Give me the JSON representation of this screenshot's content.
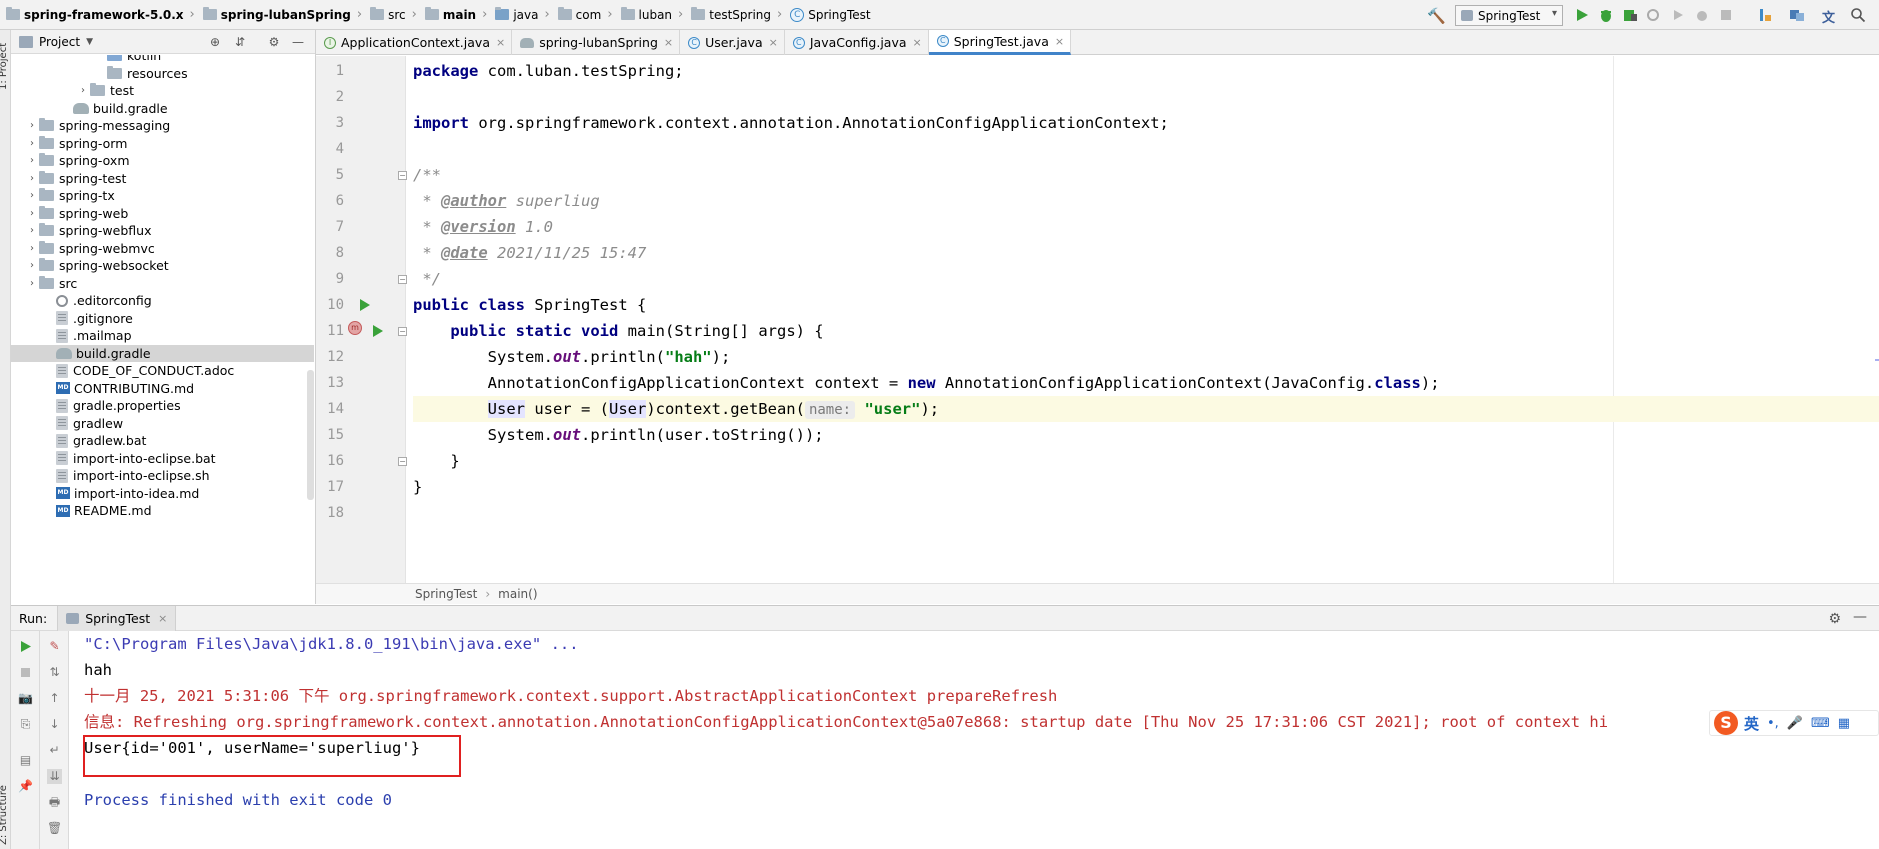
{
  "navbar": {
    "crumbs": [
      {
        "label": "spring-framework-5.0.x",
        "bold": true,
        "icon": "folder"
      },
      {
        "label": "spring-lubanSpring",
        "bold": true,
        "icon": "folder"
      },
      {
        "label": "src",
        "bold": false,
        "icon": "folder"
      },
      {
        "label": "main",
        "bold": true,
        "icon": "folder"
      },
      {
        "label": "java",
        "bold": false,
        "icon": "folder-blue"
      },
      {
        "label": "com",
        "bold": false,
        "icon": "folder"
      },
      {
        "label": "luban",
        "bold": false,
        "icon": "folder"
      },
      {
        "label": "testSpring",
        "bold": false,
        "icon": "folder"
      },
      {
        "label": "SpringTest",
        "bold": false,
        "icon": "class"
      }
    ],
    "run_config": "SpringTest"
  },
  "side": {
    "project_stripe": "1: Project",
    "structure_stripe": "Z: Structure"
  },
  "project_panel": {
    "title": "Project",
    "tree": [
      {
        "label": "kotlin",
        "indent": 5,
        "icon": "folder-blue",
        "arrow": ""
      },
      {
        "label": "resources",
        "indent": 5,
        "icon": "folder",
        "arrow": ""
      },
      {
        "label": "test",
        "indent": 4,
        "icon": "folder",
        "arrow": "›"
      },
      {
        "label": "build.gradle",
        "indent": 3,
        "icon": "gradle",
        "arrow": ""
      },
      {
        "label": "spring-messaging",
        "indent": 1,
        "icon": "folder",
        "arrow": "›"
      },
      {
        "label": "spring-orm",
        "indent": 1,
        "icon": "folder",
        "arrow": "›"
      },
      {
        "label": "spring-oxm",
        "indent": 1,
        "icon": "folder",
        "arrow": "›"
      },
      {
        "label": "spring-test",
        "indent": 1,
        "icon": "folder",
        "arrow": "›"
      },
      {
        "label": "spring-tx",
        "indent": 1,
        "icon": "folder",
        "arrow": "›"
      },
      {
        "label": "spring-web",
        "indent": 1,
        "icon": "folder",
        "arrow": "›"
      },
      {
        "label": "spring-webflux",
        "indent": 1,
        "icon": "folder",
        "arrow": "›"
      },
      {
        "label": "spring-webmvc",
        "indent": 1,
        "icon": "folder",
        "arrow": "›"
      },
      {
        "label": "spring-websocket",
        "indent": 1,
        "icon": "folder",
        "arrow": "›"
      },
      {
        "label": "src",
        "indent": 1,
        "icon": "folder",
        "arrow": "›"
      },
      {
        "label": ".editorconfig",
        "indent": 2,
        "icon": "gear",
        "arrow": ""
      },
      {
        "label": ".gitignore",
        "indent": 2,
        "icon": "file",
        "arrow": ""
      },
      {
        "label": ".mailmap",
        "indent": 2,
        "icon": "file",
        "arrow": ""
      },
      {
        "label": "build.gradle",
        "indent": 2,
        "icon": "gradle",
        "arrow": "",
        "selected": true
      },
      {
        "label": "CODE_OF_CONDUCT.adoc",
        "indent": 2,
        "icon": "file",
        "arrow": ""
      },
      {
        "label": "CONTRIBUTING.md",
        "indent": 2,
        "icon": "md",
        "arrow": ""
      },
      {
        "label": "gradle.properties",
        "indent": 2,
        "icon": "file",
        "arrow": ""
      },
      {
        "label": "gradlew",
        "indent": 2,
        "icon": "file",
        "arrow": ""
      },
      {
        "label": "gradlew.bat",
        "indent": 2,
        "icon": "file",
        "arrow": ""
      },
      {
        "label": "import-into-eclipse.bat",
        "indent": 2,
        "icon": "file",
        "arrow": ""
      },
      {
        "label": "import-into-eclipse.sh",
        "indent": 2,
        "icon": "file",
        "arrow": ""
      },
      {
        "label": "import-into-idea.md",
        "indent": 2,
        "icon": "md",
        "arrow": ""
      },
      {
        "label": "README.md",
        "indent": 2,
        "icon": "md",
        "arrow": ""
      }
    ]
  },
  "tabs": [
    {
      "label": "ApplicationContext.java",
      "icon": "interface-icon",
      "active": false
    },
    {
      "label": "spring-lubanSpring",
      "icon": "gradle-icon",
      "active": false
    },
    {
      "label": "User.java",
      "icon": "class-icon",
      "active": false
    },
    {
      "label": "JavaConfig.java",
      "icon": "class-icon",
      "active": false
    },
    {
      "label": "SpringTest.java",
      "icon": "class-icon",
      "active": true
    }
  ],
  "editor": {
    "line_numbers": [
      "1",
      "2",
      "3",
      "4",
      "5",
      "6",
      "7",
      "8",
      "9",
      "10",
      "11",
      "12",
      "13",
      "14",
      "15",
      "16",
      "17",
      "18"
    ],
    "current_line": 14,
    "code": {
      "l1_kw": "package",
      "l1_rest": " com.luban.testSpring;",
      "l3_kw": "import",
      "l3_rest": " org.springframework.context.annotation.AnnotationConfigApplicationContext;",
      "l5": "/**",
      "l6_a": " * ",
      "l6_tag": "@author",
      "l6_b": " superliug",
      "l7_a": " * ",
      "l7_tag": "@version",
      "l7_b": " 1.0",
      "l8_a": " * ",
      "l8_tag": "@date",
      "l8_b": " 2021/11/25 15:47",
      "l9": " */",
      "l10_kw1": "public",
      "l10_kw2": "class",
      "l10_rest": " SpringTest {",
      "l11_ind": "    ",
      "l11_kw1": "public",
      "l11_kw2": "static",
      "l11_kw3": "void",
      "l11_rest": " main(String[] args) {",
      "l12_a": "        System.",
      "l12_fld": "out",
      "l12_b": ".println(",
      "l12_str": "\"hah\"",
      "l12_c": ");",
      "l13_a": "        AnnotationConfigApplicationContext context = ",
      "l13_kw": "new",
      "l13_b": " AnnotationConfigApplicationContext(JavaConfig.",
      "l13_kw2": "class",
      "l13_c": ");",
      "l14_ind": "        ",
      "l14_t1": "User",
      "l14_a": " user = (",
      "l14_t2": "User",
      "l14_b": ")context.getBean(",
      "l14_hint": "name:",
      "l14_str": "\"user\"",
      "l14_c": ");",
      "l15_a": "        System.",
      "l15_fld": "out",
      "l15_b": ".println(user.toString());",
      "l16": "    }",
      "l17": "}"
    },
    "breadcrumb": [
      "SpringTest",
      "main()"
    ]
  },
  "run_panel": {
    "label": "Run:",
    "tab": "SpringTest",
    "lines": {
      "cmd": "\"C:\\Program Files\\Java\\jdk1.8.0_191\\bin\\java.exe\" ...",
      "out1": "hah",
      "err1": "十一月 25, 2021 5:31:06 下午 org.springframework.context.support.AbstractApplicationContext prepareRefresh",
      "err2": "信息: Refreshing org.springframework.context.annotation.AnnotationConfigApplicationContext@5a07e868: startup date [Thu Nov 25 17:31:06 CST 2021]; root of context hi",
      "out2": "User{id='001', userName='superliug'}",
      "fin": "Process finished with exit code 0"
    }
  },
  "ime": {
    "logo": "S",
    "lang": "英",
    "punct": "•,",
    "mic": "🎤",
    "kbd": "⌨",
    "grid": "▦"
  },
  "colors": {
    "accent": "#4083c9",
    "run_green": "#3aa23a",
    "error_red": "#c03131",
    "highlight_box": "#e02020"
  }
}
